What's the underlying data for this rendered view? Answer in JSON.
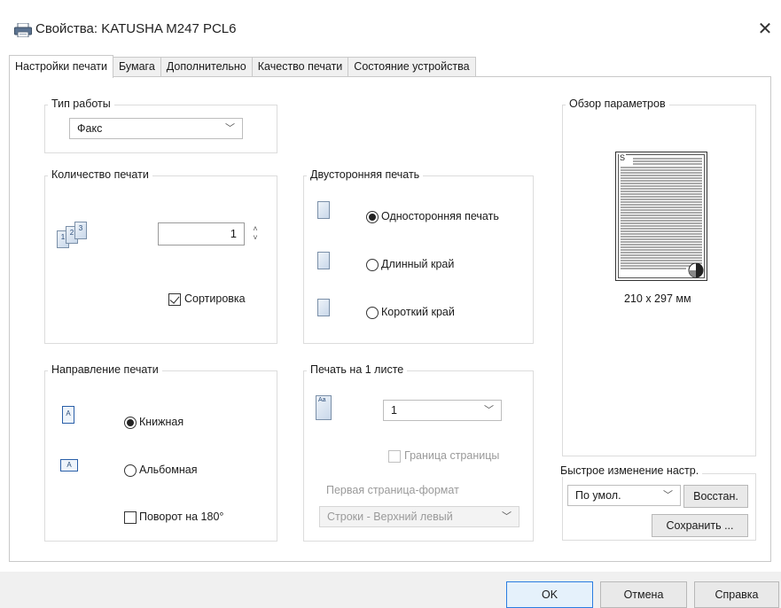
{
  "window": {
    "title": "Свойства: KATUSHA M247 PCL6",
    "close_glyph": "✕"
  },
  "tabs": [
    {
      "label": "Настройки печати"
    },
    {
      "label": "Бумага"
    },
    {
      "label": "Дополнительно"
    },
    {
      "label": "Качество печати"
    },
    {
      "label": "Состояние устройства"
    }
  ],
  "job_type": {
    "group_label": "Тип работы",
    "value": "Факс"
  },
  "copies": {
    "group_label": "Количество печати",
    "value": "1",
    "collate_label": "Сортировка",
    "collate_checked": true
  },
  "duplex": {
    "group_label": "Двусторонняя печать",
    "options": [
      {
        "label": "Односторонняя печать",
        "checked": true
      },
      {
        "label": "Длинный край",
        "checked": false
      },
      {
        "label": "Короткий край",
        "checked": false
      }
    ]
  },
  "orientation": {
    "group_label": "Направление печати",
    "portrait_label": "Книжная",
    "landscape_label": "Альбомная",
    "rotate_label": "Поворот на 180°",
    "icon_letter": "A"
  },
  "nup": {
    "group_label": "Печать на 1 листе",
    "value": "1",
    "border_label": "Граница страницы",
    "first_page_label": "Первая страница-формат",
    "order_value": "Строки - Верхний левый",
    "icon_text": "Aa"
  },
  "preview": {
    "group_label": "Обзор параметров",
    "paper_size": "210 x 297 мм",
    "page_letter": "S"
  },
  "quick": {
    "group_label": "Быстрое изменение настр.",
    "preset_value": "По умол.",
    "restore_label": "Восстан.",
    "save_label": "Сохранить ..."
  },
  "footer": {
    "ok_label": "OK",
    "cancel_label": "Отмена",
    "help_label": "Справка"
  },
  "icons": {
    "caret": "﹀",
    "spin_up": "˄",
    "spin_down": "˅"
  }
}
